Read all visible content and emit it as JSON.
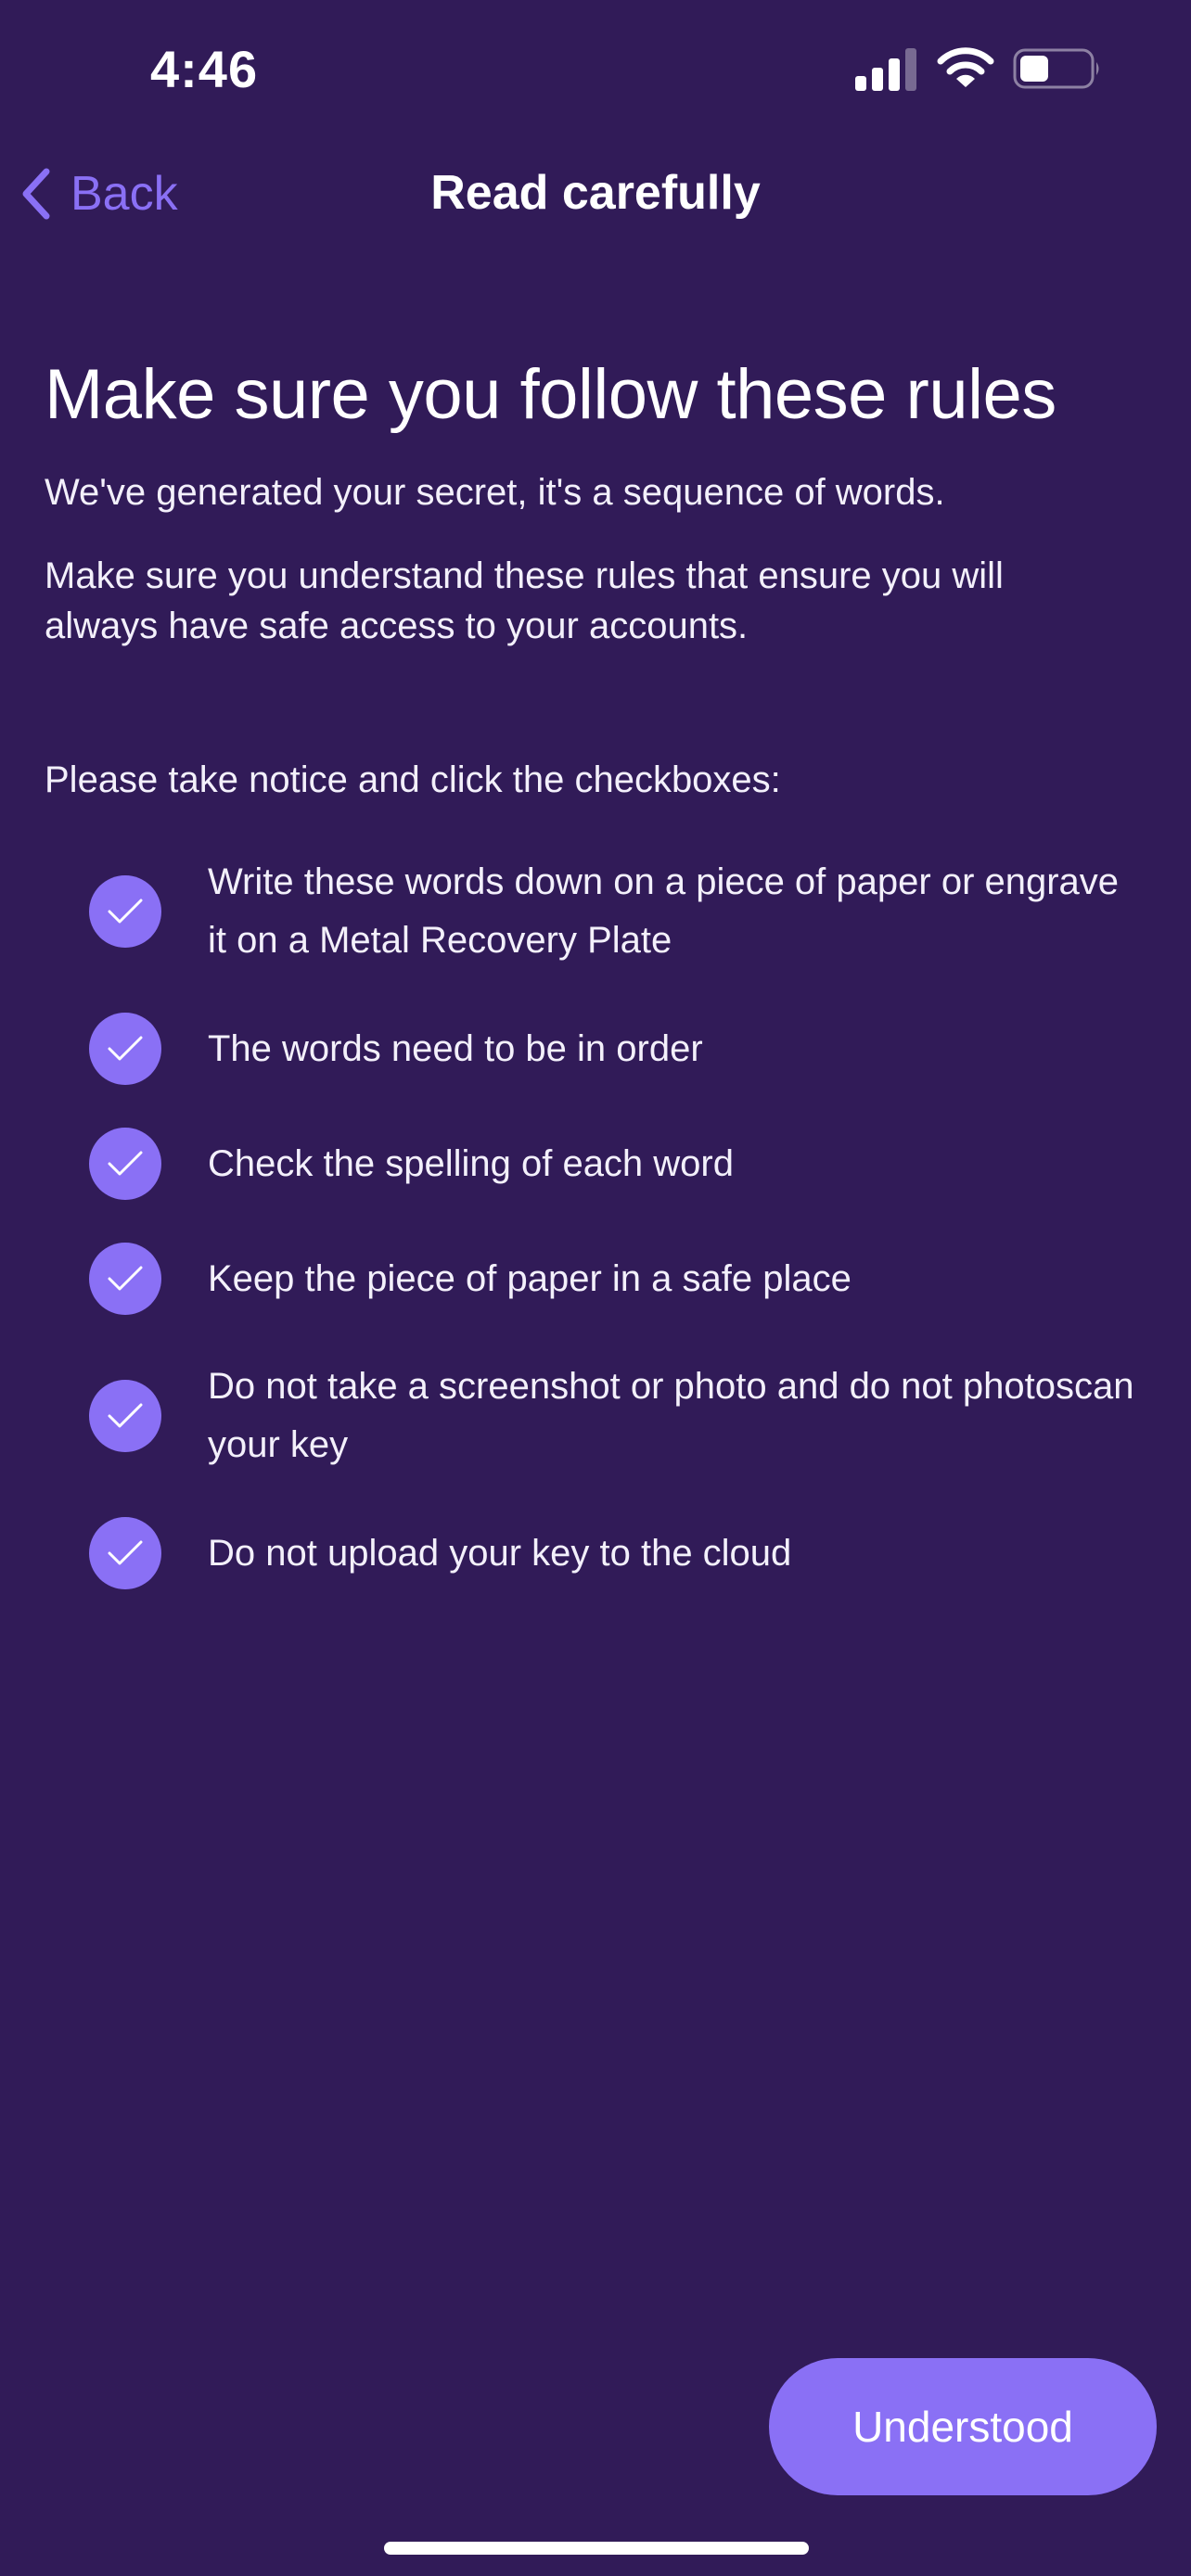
{
  "status_bar": {
    "time": "4:46",
    "icons": [
      "cellular-signal-icon",
      "wifi-icon",
      "battery-icon"
    ]
  },
  "nav": {
    "back_label": "Back",
    "title": "Read carefully"
  },
  "main": {
    "title": "Make sure you follow these rules",
    "paragraphs": [
      "We've generated your secret, it's a sequence of words.",
      "Make sure you understand these rules that ensure you will always have safe access to your accounts."
    ],
    "instruction": "Please take notice and click the checkboxes:",
    "rules": [
      {
        "text": "Write these words down on a piece of paper or engrave it on a Metal Recovery Plate",
        "checked": true
      },
      {
        "text": "The words need to be in order",
        "checked": true
      },
      {
        "text": "Check the spelling of each word",
        "checked": true
      },
      {
        "text": "Keep the piece of paper in a safe place",
        "checked": true
      },
      {
        "text": "Do not take a screenshot or photo and do not photoscan your key",
        "checked": true
      },
      {
        "text": "Do not upload your key to the cloud",
        "checked": true
      }
    ]
  },
  "footer": {
    "button_label": "Understood"
  },
  "colors": {
    "background": "#311b58",
    "accent": "#8a70f5",
    "text": "#ffffff"
  }
}
